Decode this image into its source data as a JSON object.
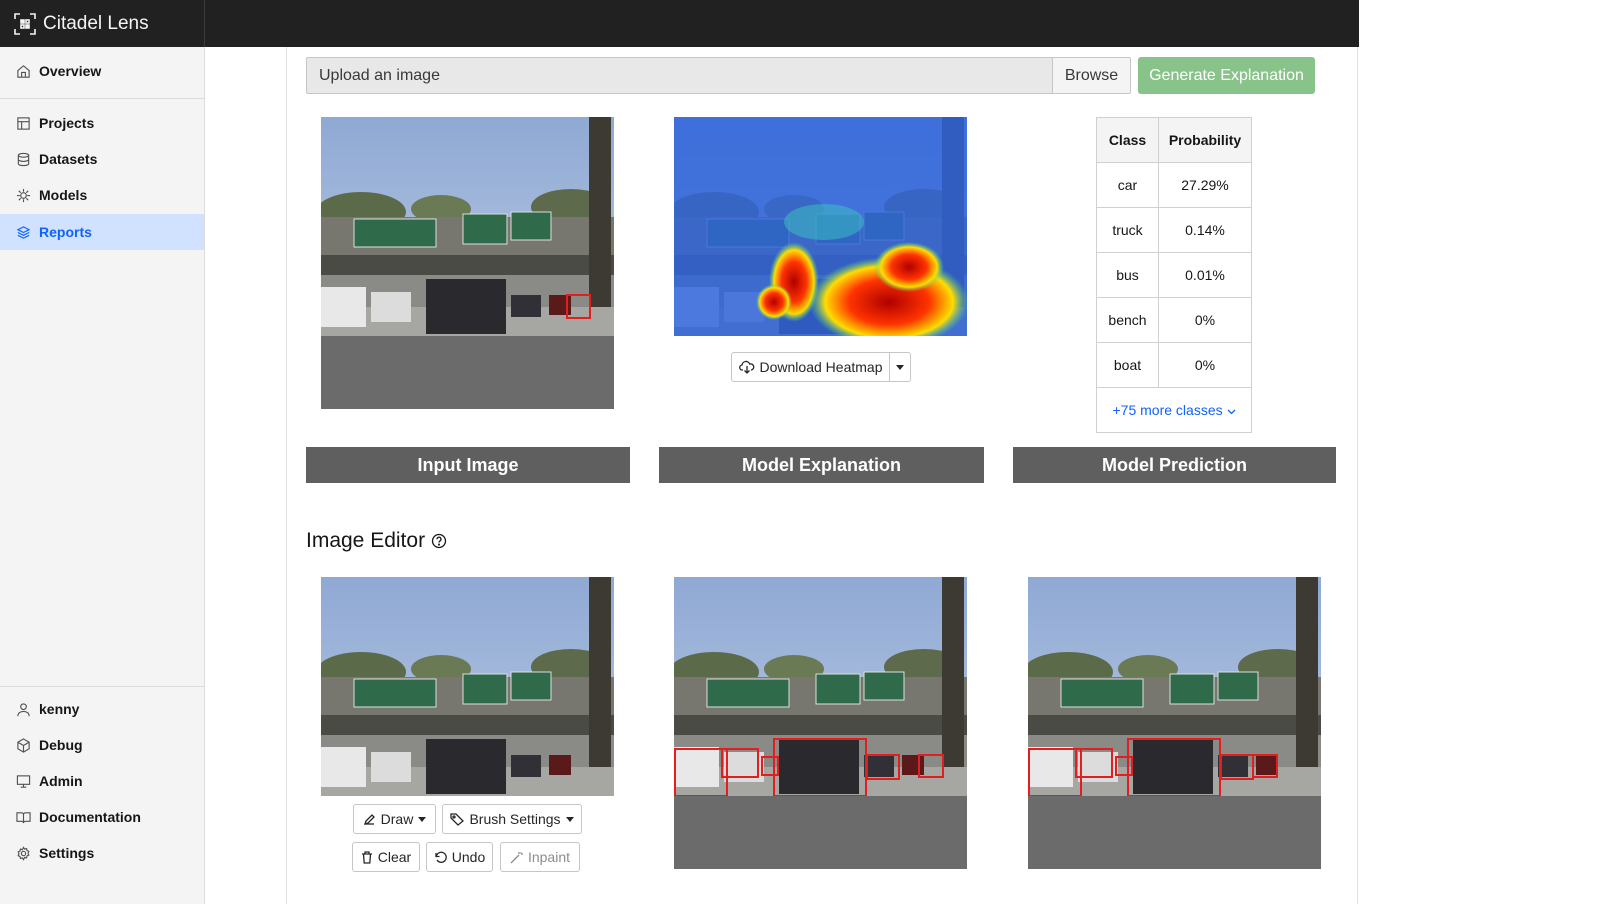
{
  "app": {
    "title": "Citadel Lens"
  },
  "sidebar": {
    "items": [
      {
        "label": "Overview",
        "icon": "home-icon"
      },
      {
        "label": "Projects",
        "icon": "table-icon"
      },
      {
        "label": "Datasets",
        "icon": "database-icon"
      },
      {
        "label": "Models",
        "icon": "model-icon"
      },
      {
        "label": "Reports",
        "icon": "layers-icon",
        "active": true
      }
    ],
    "bottom_items": [
      {
        "label": "kenny",
        "icon": "user-icon"
      },
      {
        "label": "Debug",
        "icon": "cube-icon"
      },
      {
        "label": "Admin",
        "icon": "monitor-icon"
      },
      {
        "label": "Documentation",
        "icon": "book-icon"
      },
      {
        "label": "Settings",
        "icon": "gear-icon"
      }
    ]
  },
  "upload": {
    "placeholder": "Upload an image",
    "browse_label": "Browse"
  },
  "generate_label": "Generate Explanation",
  "download_label": "Download Heatmap",
  "prediction": {
    "headers": [
      "Class",
      "Probability"
    ],
    "rows": [
      {
        "class": "car",
        "probability": "27.29%"
      },
      {
        "class": "truck",
        "probability": "0.14%"
      },
      {
        "class": "bus",
        "probability": "0.01%"
      },
      {
        "class": "bench",
        "probability": "0%"
      },
      {
        "class": "boat",
        "probability": "0%"
      }
    ],
    "more_label": "+75 more classes"
  },
  "panels": {
    "input": "Input Image",
    "explanation": "Model Explanation",
    "prediction": "Model Prediction"
  },
  "editor": {
    "title": "Image Editor",
    "draw_label": "Draw",
    "brush_label": "Brush Settings",
    "clear_label": "Clear",
    "undo_label": "Undo",
    "inpaint_label": "Inpaint"
  },
  "colors": {
    "accent": "#0f62fe",
    "generate": "#88c38a",
    "label_bar": "#5f5f5f",
    "box": "#e02020"
  }
}
